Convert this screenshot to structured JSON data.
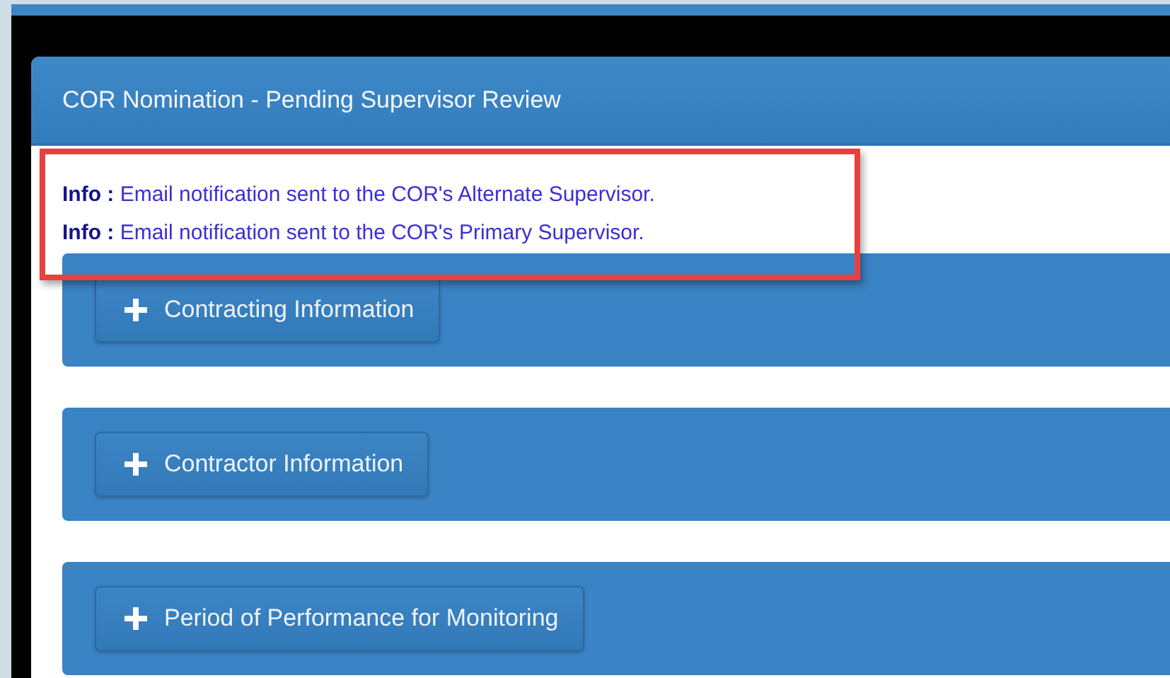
{
  "panel": {
    "title": "COR Nomination - Pending Supervisor Review"
  },
  "messages_highlighted": true,
  "messages": [
    {
      "label": "Info :",
      "text": "Email notification sent to the COR's Alternate Supervisor."
    },
    {
      "label": "Info :",
      "text": "Email notification sent to the COR's Primary Supervisor."
    }
  ],
  "sections": [
    {
      "label": "Contracting Information",
      "expanded": false
    },
    {
      "label": "Contractor Information",
      "expanded": false
    },
    {
      "label": "Period of Performance for Monitoring",
      "expanded": false
    }
  ]
}
